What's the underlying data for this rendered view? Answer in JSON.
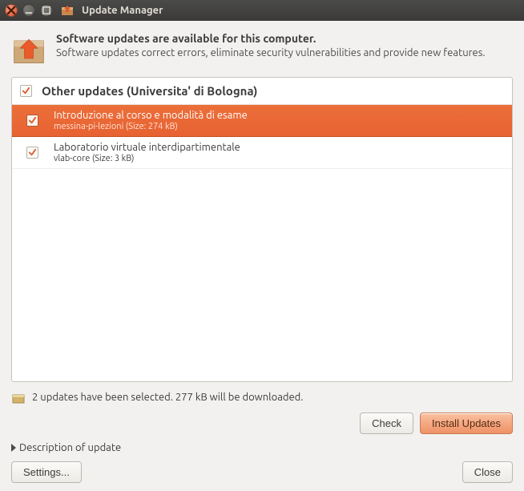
{
  "window": {
    "title": "Update Manager"
  },
  "header": {
    "heading": "Software updates are available for this computer.",
    "subtext": "Software updates correct errors, eliminate security vulnerabilities and provide new features."
  },
  "list": {
    "group_title": "Other updates (Universita' di Bologna)",
    "items": [
      {
        "title": "Introduzione al corso e modalità di esame",
        "subtitle": "messina-pi-lezioni (Size: 274 kB)",
        "selected": true,
        "checked": true
      },
      {
        "title": "Laboratorio virtuale interdipartimentale",
        "subtitle": "vlab-core (Size: 3 kB)",
        "selected": false,
        "checked": true
      }
    ]
  },
  "status": "2 updates have been selected. 277 kB will be downloaded.",
  "buttons": {
    "check": "Check",
    "install": "Install Updates",
    "settings": "Settings...",
    "close": "Close"
  },
  "expander": {
    "label": "Description of update"
  },
  "colors": {
    "accent": "#e86232"
  }
}
